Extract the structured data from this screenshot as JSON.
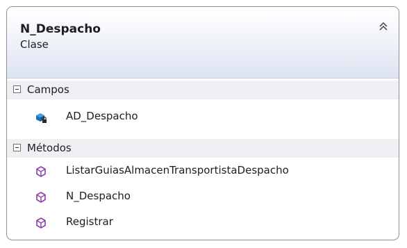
{
  "class": {
    "name": "N_Despacho",
    "stereotype": "Clase"
  },
  "sections": {
    "campos": {
      "label": "Campos",
      "items": [
        {
          "label": "AD_Despacho",
          "icon": "private-field-icon"
        }
      ]
    },
    "metodos": {
      "label": "Métodos",
      "items": [
        {
          "label": "ListarGuiasAlmacenTransportistaDespacho",
          "icon": "method-icon"
        },
        {
          "label": "N_Despacho",
          "icon": "method-icon"
        },
        {
          "label": "Registrar",
          "icon": "method-icon"
        }
      ]
    }
  },
  "colors": {
    "header_gradient_end": "#dde3f1",
    "section_background": "#eef0f4",
    "method_icon": "#8a3fa8",
    "field_icon": "#1f6fb5"
  }
}
